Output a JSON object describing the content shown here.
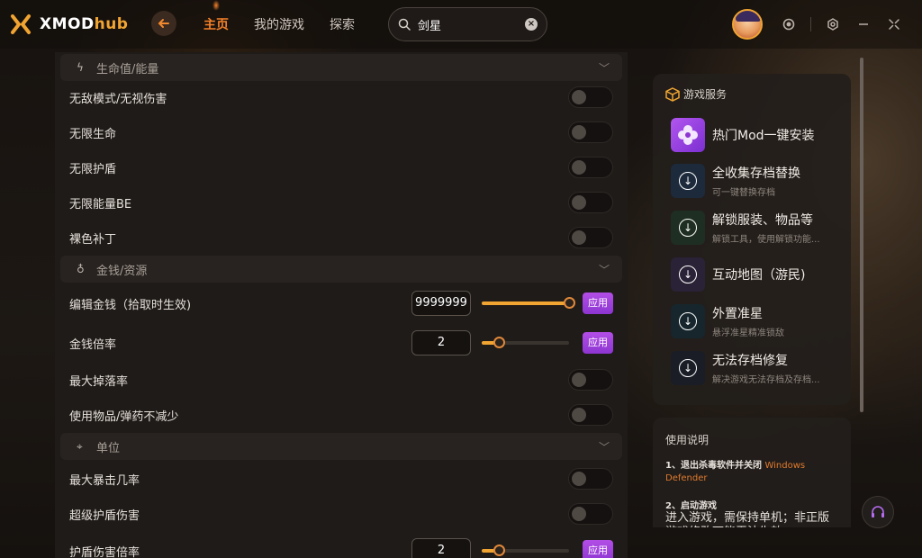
{
  "app": {
    "logo_text_main": "XMOD",
    "logo_text_accent": "hub",
    "brand_color": "#f6812a",
    "accent_purple": "#9a3fdc"
  },
  "nav": {
    "back_icon": "arrow-left-icon",
    "items": [
      "主页",
      "我的游戏",
      "探索"
    ],
    "active_index": 0
  },
  "search": {
    "value": "剑星",
    "icon": "search-icon",
    "clear_icon": "close-icon"
  },
  "window_icons": [
    "notification-icon",
    "settings-icon",
    "minimize-icon",
    "maximize-icon"
  ],
  "sections": [
    {
      "title": "生命值/能量",
      "icon": "lightning-icon",
      "rows": [
        {
          "label": "无敌模式/无视伤害",
          "type": "toggle",
          "on": false
        },
        {
          "label": "无限生命",
          "type": "toggle",
          "on": false
        },
        {
          "label": "无限护盾",
          "type": "toggle",
          "on": false
        },
        {
          "label": "无限能量BE",
          "type": "toggle",
          "on": false
        },
        {
          "label": "裸色补丁",
          "type": "toggle",
          "on": false
        }
      ]
    },
    {
      "title": "金钱/资源",
      "icon": "money-bag-icon",
      "rows": [
        {
          "label": "编辑金钱（拾取时生效)",
          "type": "slider",
          "value": "9999999",
          "fraction": 1.0,
          "apply": "应用"
        },
        {
          "label": "金钱倍率",
          "type": "slider",
          "value": "2",
          "fraction": 0.2,
          "apply": "应用"
        },
        {
          "label": "最大掉落率",
          "type": "toggle",
          "on": false
        },
        {
          "label": "使用物品/弹药不减少",
          "type": "toggle",
          "on": false
        }
      ]
    },
    {
      "title": "单位",
      "icon": "unit-icon",
      "rows": [
        {
          "label": "最大暴击几率",
          "type": "toggle",
          "on": false
        },
        {
          "label": "超级护盾伤害",
          "type": "toggle",
          "on": false
        },
        {
          "label": "护盾伤害倍率",
          "type": "slider",
          "value": "2",
          "fraction": 0.2,
          "apply": "应用"
        }
      ]
    }
  ],
  "services": {
    "title": "游戏服务",
    "items": [
      {
        "title": "热门Mod一键安装",
        "sub": "",
        "icon": "mod-flower-icon"
      },
      {
        "title": "全收集存档替换",
        "sub": "可一键替换存档",
        "icon": "download-icon"
      },
      {
        "title": "解锁服装、物品等",
        "sub": "解锁工具，使用解锁功能...",
        "icon": "download-icon"
      },
      {
        "title": "互动地图（游民)",
        "sub": "",
        "icon": "download-icon"
      },
      {
        "title": "外置准星",
        "sub": "悬浮准星精准锁敌",
        "icon": "download-icon"
      },
      {
        "title": "无法存档修复",
        "sub": "解决游戏无法存档及存档...",
        "icon": "download-icon"
      }
    ]
  },
  "instructions": {
    "title": "使用说明",
    "step1_prefix": "1、退出杀毒软件并关闭",
    "step1_highlight": "Windows Defender",
    "step2_title": "2、启动游戏",
    "step2_text": "进入游戏，需保持单机；非正版游戏修改可能无法生效"
  },
  "help_icon": "headset-icon"
}
